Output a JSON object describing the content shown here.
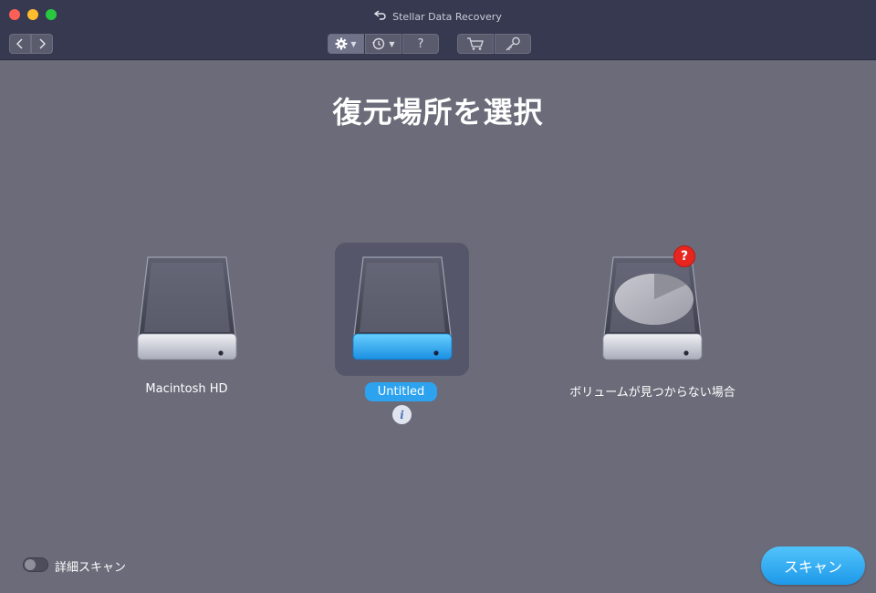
{
  "window": {
    "title": "Stellar Data Recovery"
  },
  "toolbar": {
    "back_icon": "chevron-left-icon",
    "forward_icon": "chevron-right-icon",
    "settings_icon": "gear-icon",
    "history_icon": "history-icon",
    "help_label": "?",
    "cart_icon": "cart-icon",
    "key_icon": "key-icon"
  },
  "main": {
    "heading": "復元場所を選択",
    "drives": [
      {
        "label": "Macintosh HD",
        "selected": false,
        "accent": "#c9cdd8"
      },
      {
        "label": "Untitled",
        "selected": true,
        "accent": "#31b4f6"
      },
      {
        "label": "ボリュームが見つからない場合",
        "selected": false,
        "accent": "#c9cdd8",
        "badge": "?"
      }
    ],
    "info_label": "i"
  },
  "footer": {
    "deep_scan_label": "詳細スキャン",
    "deep_scan_on": false,
    "scan_label": "スキャン"
  },
  "colors": {
    "background": "#6b6b79",
    "titlebar": "#373951",
    "accent_blue": "#2da3f0",
    "badge_red": "#e8261f"
  }
}
